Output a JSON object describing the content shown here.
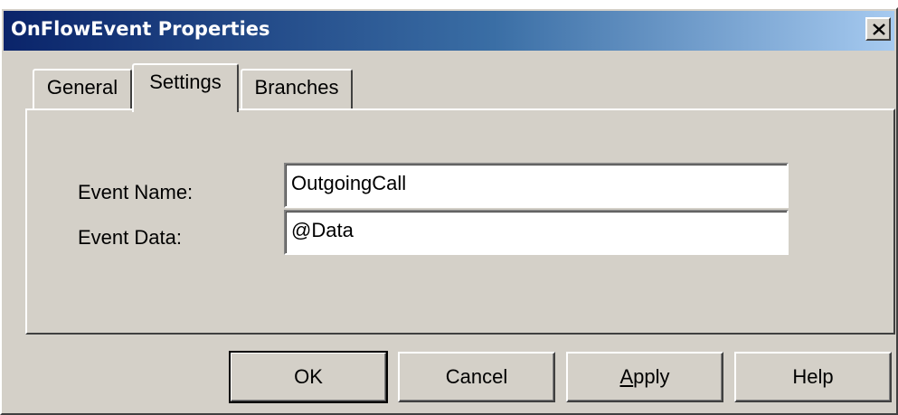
{
  "window": {
    "title": "OnFlowEvent Properties",
    "close_icon": "close-icon"
  },
  "tabs": [
    {
      "label": "General",
      "active": false
    },
    {
      "label": "Settings",
      "active": true
    },
    {
      "label": "Branches",
      "active": false
    }
  ],
  "settings": {
    "event_name_label": "Event Name:",
    "event_name_value": "OutgoingCall",
    "event_data_label": "Event Data:",
    "event_data_value": "@Data"
  },
  "buttons": {
    "ok": "OK",
    "cancel": "Cancel",
    "apply": "Apply",
    "help": "Help"
  },
  "colors": {
    "titlebar_start": "#0a246a",
    "titlebar_end": "#a6caf0",
    "face": "#d4d0c8"
  }
}
